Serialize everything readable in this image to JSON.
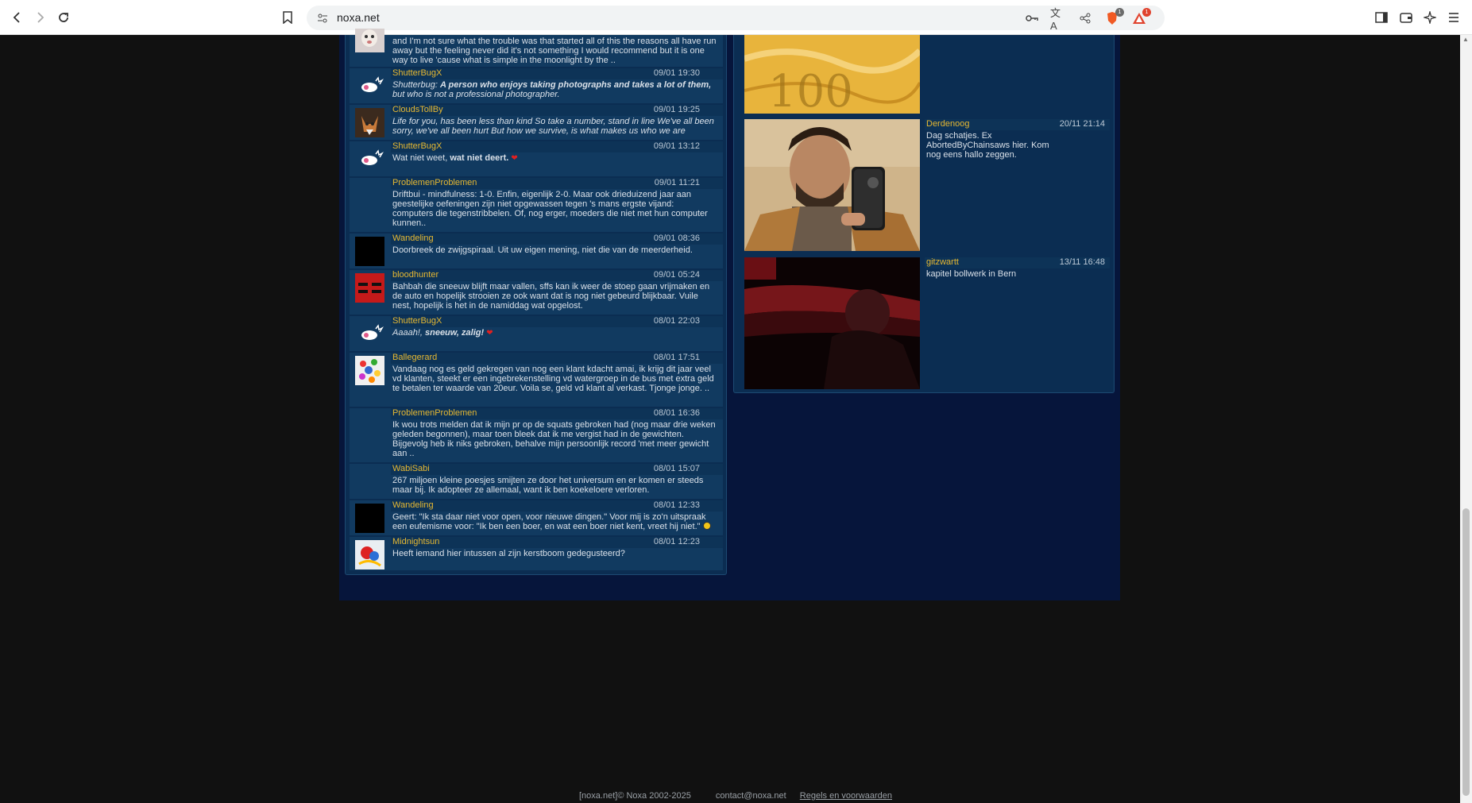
{
  "browser": {
    "url": "noxa.net",
    "brave_badge_count": "1",
    "alert_badge_count": "1"
  },
  "posts": [
    {
      "user": "",
      "time": "",
      "text": "and I'm not sure what the trouble was that started all of this the reasons all have run away but the feeling never did it's not something I would recommend but it is one way to live 'cause what is simple in the moonlight by the .."
    },
    {
      "user": "ShutterBugX",
      "time": "09/01 19:30",
      "text_prefix": "Shutterbug: ",
      "text_bold": "A person who enjoys taking photographs and takes a lot of them,",
      "text": " but who is not a professional photographer."
    },
    {
      "user": "CloudsTollBy",
      "time": "09/01 19:25",
      "text": "Life for you, has been less than kind So take a number, stand in line We've all been sorry, we've all been hurt But how we survive, is what makes us who we are"
    },
    {
      "user": "ShutterBugX",
      "time": "09/01 13:12",
      "text": "Wat niet weet, ",
      "text_bold": "wat niet deert."
    },
    {
      "user": "ProblemenProblemen",
      "time": "09/01 11:21",
      "text": "Driftbui - mindfulness: 1-0. Enfin, eigenlijk 2-0. Maar ook drieduizend jaar aan geestelijke oefeningen zijn niet opgewassen tegen 's mans ergste vijand: computers die tegenstribbelen. Of, nog erger, moeders die niet met hun computer kunnen.."
    },
    {
      "user": "Wandeling",
      "time": "09/01 08:36",
      "text": "Doorbreek de zwijgspiraal. Uit uw eigen mening, niet die van de meerderheid."
    },
    {
      "user": "bloodhunter",
      "time": "09/01 05:24",
      "text": "Bahbah die sneeuw blijft maar vallen, sffs kan ik weer de stoep gaan vrijmaken en de auto en hopelijk strooien ze ook want dat is nog niet gebeurd blijkbaar. Vuile nest, hopelijk is het in de namiddag wat opgelost."
    },
    {
      "user": "ShutterBugX",
      "time": "08/01 22:03",
      "text": "Aaaah!, ",
      "text_bold": "sneeuw, zalig!"
    },
    {
      "user": "Ballegerard",
      "time": "08/01 17:51",
      "text": "Vandaag nog es geld gekregen van nog een klant kdacht amai, ik krijg dit jaar veel vd klanten, steekt er een ingebrekenstelling vd watergroep in de bus met extra geld te betalen ter waarde van 20eur. Voila se, geld vd klant al verkast. Tjonge jonge. .."
    },
    {
      "user": "ProblemenProblemen",
      "time": "08/01 16:36",
      "text": "Ik wou trots melden dat ik mijn pr op de squats gebroken had (nog maar drie weken geleden begonnen), maar toen bleek dat ik me vergist had in de gewichten. Bijgevolg heb ik niks gebroken, behalve mijn persoonlijk record 'met meer gewicht aan .."
    },
    {
      "user": "WabiSabi",
      "time": "08/01 15:07",
      "text": "267 miljoen kleine poesjes smijten ze door het universum en er komen er steeds maar bij. Ik adopteer ze allemaal, want ik ben koekeloere verloren."
    },
    {
      "user": "Wandeling",
      "time": "08/01 12:33",
      "text": "Geert: \"Ik sta daar niet voor open, voor nieuwe dingen.\" Voor mij is zo'n uitspraak een eufemisme voor: \"Ik ben een boer, en wat een boer niet kent, vreet hij niet.\""
    },
    {
      "user": "Midnightsun",
      "time": "08/01 12:23",
      "text": "Heeft iemand hier intussen al zijn kerstboom gedegusteerd?"
    }
  ],
  "photo_posts": [
    {
      "user": "Derdenoog",
      "time": "20/11 21:14",
      "text": "Dag schatjes. Ex AbortedByChainsaws hier. Kom nog eens hallo zeggen."
    },
    {
      "user": "gitzwartt",
      "time": "13/11 16:48",
      "text": "kapitel bollwerk in Bern"
    }
  ],
  "footer": {
    "copyright": "[noxa.net]© Noxa 2002-2025",
    "contact": "contact@noxa.net",
    "terms": "Regels en voorwaarden"
  },
  "colors": {
    "page_bg": "#111111",
    "site_bg": "#06153b",
    "panel_bg": "#0b2d52",
    "username": "#e6b832"
  }
}
